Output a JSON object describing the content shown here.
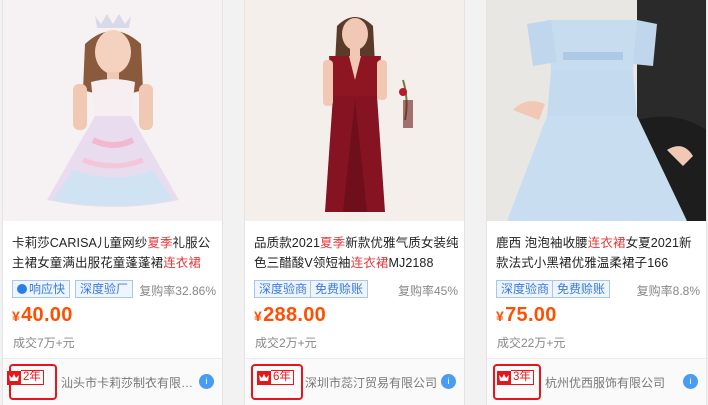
{
  "products": [
    {
      "title_a": "卡莉莎CARISA儿童网纱",
      "title_hl1": "夏季",
      "title_b": "礼服公主裙女童满出服花童蓬蓬裙",
      "title_hl2": "连衣裙",
      "title_c": "",
      "tags": [
        {
          "label": "响应快",
          "icon": "lightning-dot-icon"
        },
        {
          "label": "深度验厂"
        }
      ],
      "repurchase": "复购率32.86%",
      "currency": "¥",
      "price": "40.00",
      "deal": "成交7万+元",
      "years": "2年",
      "company": "汕头市卡莉莎制衣有限公司"
    },
    {
      "title_a": "品质款2021",
      "title_hl1": "夏季",
      "title_b": "新款优雅气质女装纯色三醋酸V领短袖",
      "title_hl2": "连衣裙",
      "title_c": "MJ2188",
      "tags": [
        {
          "label": "深度验商"
        },
        {
          "label": "免费赊账"
        }
      ],
      "repurchase": "复购率45%",
      "currency": "¥",
      "price": "288.00",
      "deal": "成交2万+元",
      "years": "6年",
      "company": "深圳市蕊汀贸易有限公司"
    },
    {
      "title_a": "鹿西 泡泡袖收腰",
      "title_hl1": "连衣裙",
      "title_b": "女夏2021新款法式小黑裙优雅温柔裙子166",
      "title_hl2": "",
      "title_c": "",
      "tags": [
        {
          "label": "深度验商"
        },
        {
          "label": "免费赊账"
        }
      ],
      "repurchase": "复购率8.8%",
      "currency": "¥",
      "price": "75.00",
      "deal": "成交22万+元",
      "years": "3年",
      "company": "杭州优西服饰有限公司"
    }
  ],
  "chat_icon": "chat-bubble-icon",
  "colors": {
    "accent_red": "#e6171c",
    "price_orange": "#ff5000",
    "tag_blue": "#3a7bd5"
  }
}
